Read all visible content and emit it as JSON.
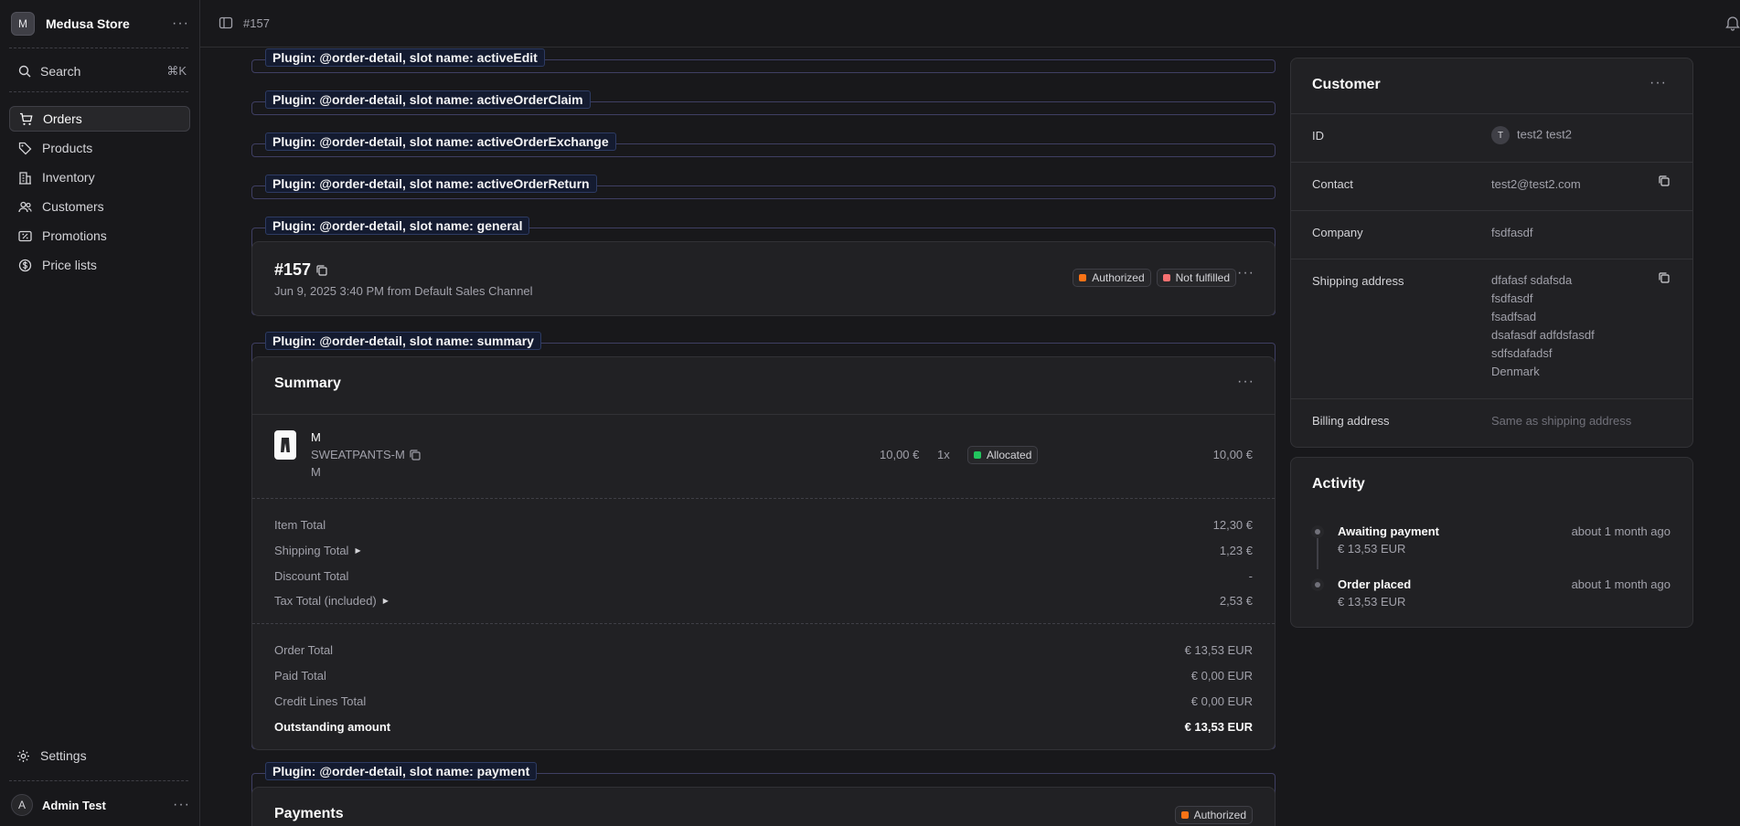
{
  "sidebar": {
    "store_initial": "M",
    "store_name": "Medusa Store",
    "search_label": "Search",
    "search_shortcut": "⌘K",
    "items": [
      {
        "label": "Orders",
        "icon": "shopping-cart-icon",
        "active": true
      },
      {
        "label": "Products",
        "icon": "tag-icon",
        "active": false
      },
      {
        "label": "Inventory",
        "icon": "building-icon",
        "active": false
      },
      {
        "label": "Customers",
        "icon": "users-icon",
        "active": false
      },
      {
        "label": "Promotions",
        "icon": "receipt-percent-icon",
        "active": false
      },
      {
        "label": "Price lists",
        "icon": "currency-icon",
        "active": false
      }
    ],
    "settings_label": "Settings",
    "user_initial": "A",
    "user_name": "Admin Test"
  },
  "topbar": {
    "breadcrumb": "#157"
  },
  "slots": {
    "active_edit": "Plugin: @order-detail, slot name: activeEdit",
    "active_claim": "Plugin: @order-detail, slot name: activeOrderClaim",
    "active_exchange": "Plugin: @order-detail, slot name: activeOrderExchange",
    "active_return": "Plugin: @order-detail, slot name: activeOrderReturn",
    "general": "Plugin: @order-detail, slot name: general",
    "summary": "Plugin: @order-detail, slot name: summary",
    "payment": "Plugin: @order-detail, slot name: payment"
  },
  "order": {
    "id": "#157",
    "subtitle": "Jun 9, 2025 3:40 PM from Default Sales Channel",
    "payment_status": "Authorized",
    "fulfillment_status": "Not fulfilled"
  },
  "summary": {
    "title": "Summary",
    "item": {
      "title": "M",
      "sku": "SWEATPANTS-M",
      "variant": "M",
      "unit_price": "10,00 €",
      "quantity": "1x",
      "status": "Allocated",
      "total": "10,00 €"
    },
    "totals": {
      "item_total_label": "Item Total",
      "item_total": "12,30 €",
      "shipping_total_label": "Shipping Total",
      "shipping_total": "1,23 €",
      "discount_total_label": "Discount Total",
      "discount_total": "-",
      "tax_total_label": "Tax Total (included)",
      "tax_total": "2,53 €"
    },
    "amounts": {
      "order_total_label": "Order Total",
      "order_total": "€ 13,53 EUR",
      "paid_total_label": "Paid Total",
      "paid_total": "€ 0,00 EUR",
      "credit_lines_label": "Credit Lines Total",
      "credit_lines": "€ 0,00 EUR",
      "outstanding_label": "Outstanding amount",
      "outstanding": "€ 13,53 EUR"
    }
  },
  "payments": {
    "title": "Payments",
    "status": "Authorized"
  },
  "customer": {
    "title": "Customer",
    "id_label": "ID",
    "id_initial": "T",
    "id_value": "test2 test2",
    "contact_label": "Contact",
    "contact_value": "test2@test2.com",
    "company_label": "Company",
    "company_value": "fsdfasdf",
    "shipping_label": "Shipping address",
    "shipping_lines": [
      "dfafasf sdafsda",
      "fsdfasdf",
      "fsadfsad",
      "dsafasdf adfdsfasdf",
      "sdfsdafadsf",
      "Denmark"
    ],
    "billing_label": "Billing address",
    "billing_value": "Same as shipping address"
  },
  "activity": {
    "title": "Activity",
    "events": [
      {
        "title": "Awaiting payment",
        "amount": "€ 13,53 EUR",
        "time": "about 1 month ago"
      },
      {
        "title": "Order placed",
        "amount": "€ 13,53 EUR",
        "time": "about 1 month ago"
      }
    ]
  },
  "colors": {
    "authorized": "#f97316",
    "not_fulfilled": "#f87171",
    "allocated": "#22c55e"
  }
}
